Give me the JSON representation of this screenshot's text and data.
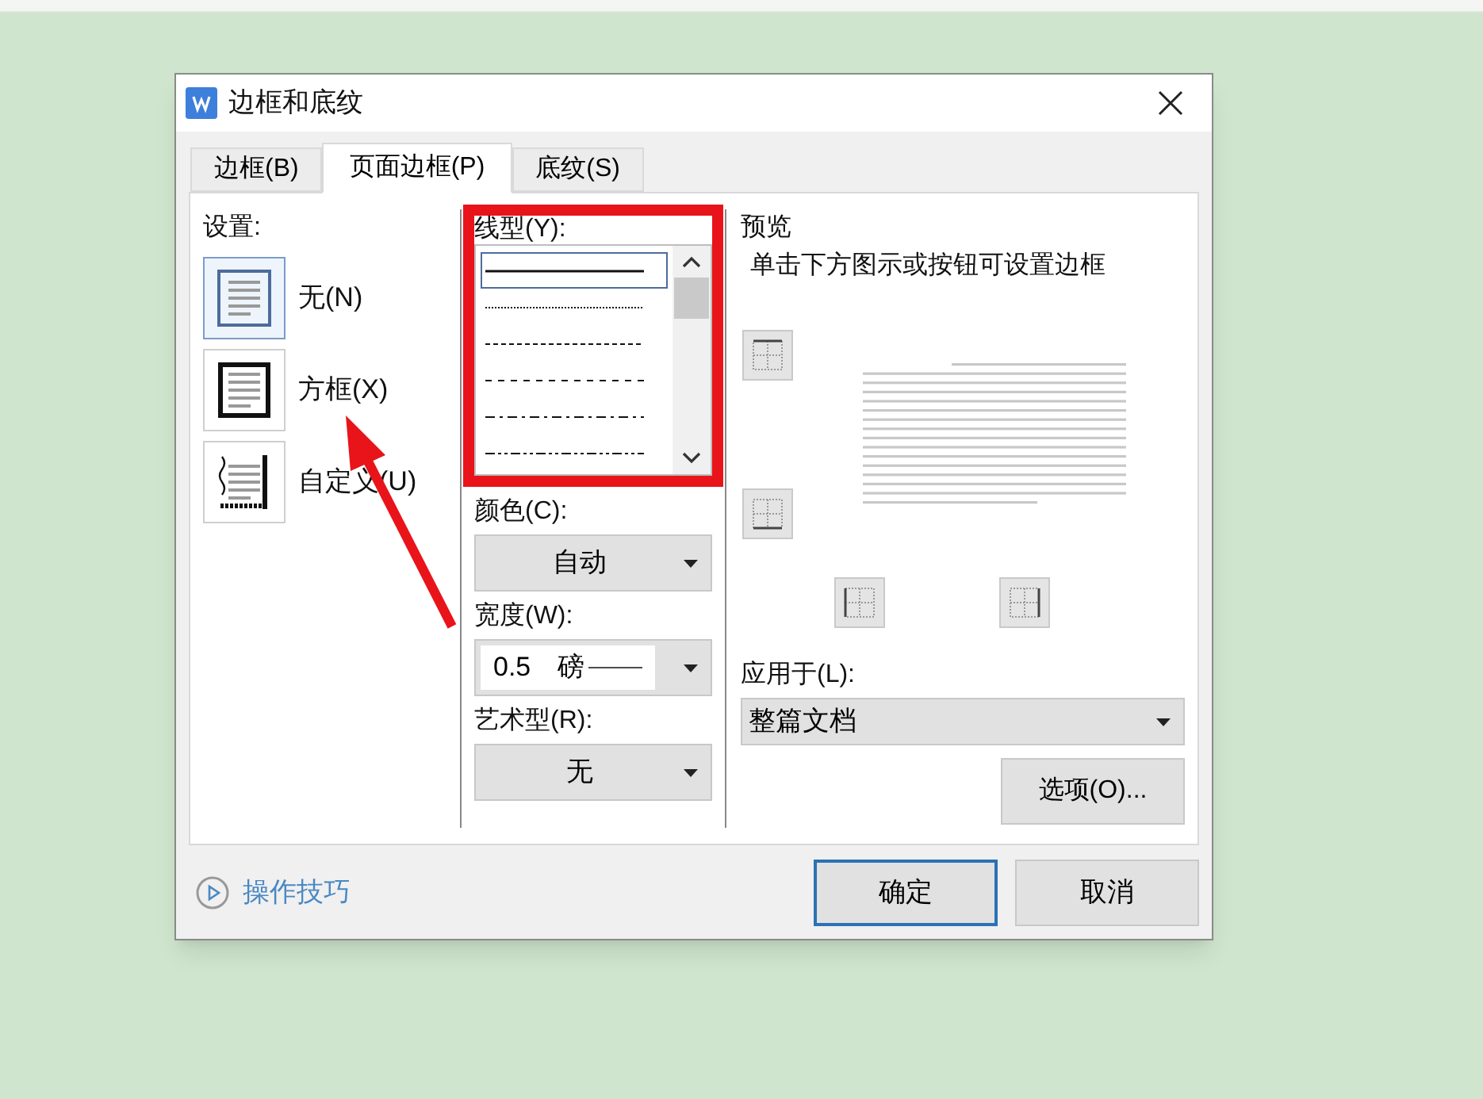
{
  "window": {
    "title": "边框和底纹"
  },
  "tabs": [
    {
      "label": "边框(B)",
      "selected": false
    },
    {
      "label": "页面边框(P)",
      "selected": true
    },
    {
      "label": "底纹(S)",
      "selected": false
    }
  ],
  "settings": {
    "label": "设置:",
    "items": [
      {
        "kind": "none",
        "label": "无(N)",
        "selected": true
      },
      {
        "kind": "box",
        "label": "方框(X)",
        "selected": false
      },
      {
        "kind": "custom",
        "label": "自定义(U)",
        "selected": false
      }
    ]
  },
  "line_style": {
    "label": "线型(Y):",
    "styles": [
      {
        "kind": "solid",
        "selected": true
      },
      {
        "kind": "dotted",
        "selected": false
      },
      {
        "kind": "dashed-small",
        "selected": false
      },
      {
        "kind": "dashed",
        "selected": false
      },
      {
        "kind": "dash-dot",
        "selected": false
      },
      {
        "kind": "dash-dot-dot",
        "selected": false
      }
    ]
  },
  "color": {
    "label": "颜色(C):",
    "value": "自动"
  },
  "width": {
    "label": "宽度(W):",
    "value": "0.5　磅"
  },
  "art": {
    "label": "艺术型(R):",
    "value": "无"
  },
  "preview": {
    "label": "预览",
    "hint": "单击下方图示或按钮可设置边框"
  },
  "apply_to": {
    "label": "应用于(L):",
    "value": "整篇文档"
  },
  "options_button": "选项(O)...",
  "tips_link": "操作技巧",
  "buttons": [
    {
      "label": "确定",
      "default": true
    },
    {
      "label": "取消",
      "default": false
    }
  ]
}
